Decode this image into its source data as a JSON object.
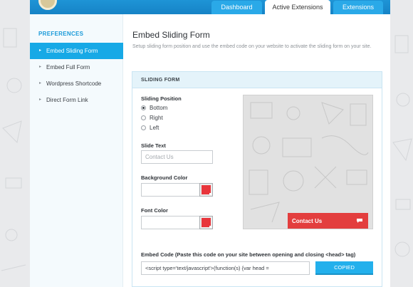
{
  "tabs": [
    {
      "label": "Dashboard",
      "active": false
    },
    {
      "label": "Active Extensions",
      "active": true
    },
    {
      "label": "Extensions",
      "active": false
    }
  ],
  "sidebar": {
    "heading": "PREFERENCES",
    "items": [
      {
        "label": "Embed Sliding Form",
        "active": true
      },
      {
        "label": "Embed Full Form",
        "active": false
      },
      {
        "label": "Wordpress Shortcode",
        "active": false
      },
      {
        "label": "Direct Form Link",
        "active": false
      }
    ]
  },
  "main": {
    "title": "Embed Sliding Form",
    "description": "Setup sliding form position and use the embed code on your website to activate the sliding form on your site."
  },
  "panel": {
    "heading": "SLIDING FORM",
    "position_label": "Sliding Position",
    "positions": [
      {
        "label": "Bottom",
        "checked": true
      },
      {
        "label": "Right",
        "checked": false
      },
      {
        "label": "Left",
        "checked": false
      }
    ],
    "slide_text_label": "Slide Text",
    "slide_text_placeholder": "Contact Us",
    "bg_color_label": "Background Color",
    "bg_color_value": "#e8353b",
    "font_color_label": "Font Color",
    "font_color_value": "#e8353b",
    "preview_button_label": "Contact Us",
    "embed_label": "Embed Code (Paste this code on your site between opening and closing <head> tag)",
    "embed_code": "<script type='text/javascript'>(function(s) {var head =",
    "copy_button_label": "COPIED"
  },
  "colors": {
    "accent": "#17a9e6",
    "topbar": "#1683c6",
    "preview_cta": "#e33e3e"
  }
}
